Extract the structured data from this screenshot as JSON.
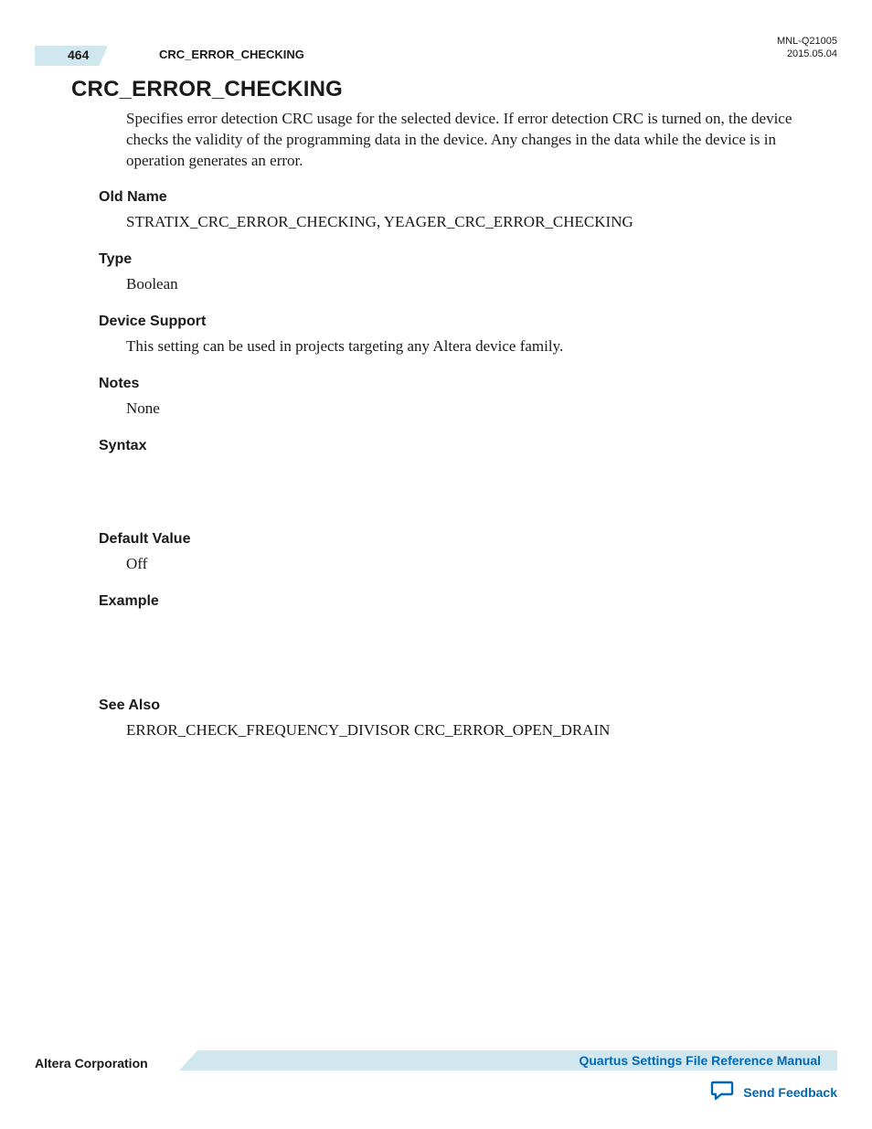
{
  "header": {
    "page_number": "464",
    "running_title": "CRC_ERROR_CHECKING",
    "doc_id": "MNL-Q21005",
    "date": "2015.05.04"
  },
  "main": {
    "title": "CRC_ERROR_CHECKING",
    "description": "Specifies error detection CRC usage for the selected device. If error detection CRC is turned on, the device checks the validity of the programming data in the device. Any changes in the data while the device is in operation generates an error.",
    "sections": {
      "old_name": {
        "heading": "Old Name",
        "body": "STRATIX_CRC_ERROR_CHECKING, YEAGER_CRC_ERROR_CHECKING"
      },
      "type": {
        "heading": "Type",
        "body": "Boolean"
      },
      "device_support": {
        "heading": "Device Support",
        "body": "This setting can be used in projects targeting any Altera device family."
      },
      "notes": {
        "heading": "Notes",
        "body": "None"
      },
      "syntax": {
        "heading": "Syntax",
        "body": ""
      },
      "default_value": {
        "heading": "Default Value",
        "body": "Off"
      },
      "example": {
        "heading": "Example",
        "body": ""
      },
      "see_also": {
        "heading": "See Also",
        "body": "ERROR_CHECK_FREQUENCY_DIVISOR CRC_ERROR_OPEN_DRAIN"
      }
    }
  },
  "footer": {
    "company": "Altera Corporation",
    "manual_link": "Quartus Settings File Reference Manual",
    "feedback": "Send Feedback"
  }
}
